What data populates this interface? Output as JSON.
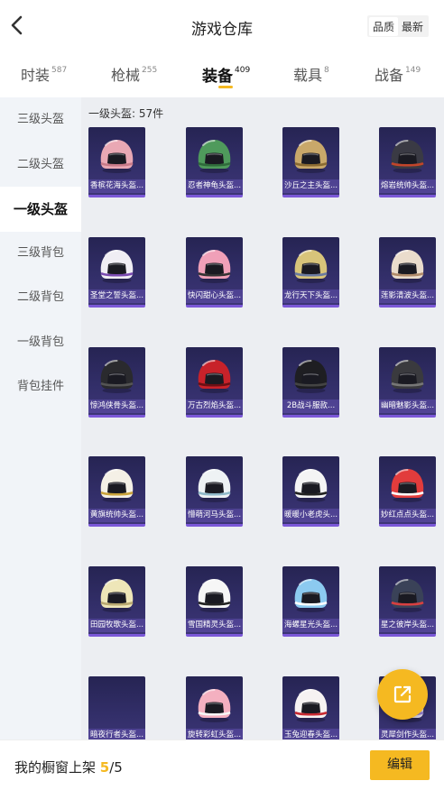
{
  "header": {
    "title": "游戏仓库",
    "sort_options": [
      "品质",
      "最新"
    ]
  },
  "tabs": [
    {
      "label": "时装",
      "count": "587"
    },
    {
      "label": "枪械",
      "count": "255"
    },
    {
      "label": "装备",
      "count": "409"
    },
    {
      "label": "载具",
      "count": "8"
    },
    {
      "label": "战备",
      "count": "149"
    }
  ],
  "sidebar": {
    "items": [
      "三级头盔",
      "二级头盔",
      "一级头盔",
      "三级背包",
      "二级背包",
      "一级背包",
      "背包挂件"
    ]
  },
  "main": {
    "count_label": "一级头盔: 57件",
    "items": [
      {
        "name": "香槟花海头盔...",
        "shell": "#e9a8b4",
        "trim": "#c77a88"
      },
      {
        "name": "忍者神龟头盔...",
        "shell": "#4f9a5c",
        "trim": "#2f6a3b"
      },
      {
        "name": "沙丘之主头盔...",
        "shell": "#c9a86a",
        "trim": "#8a6a32"
      },
      {
        "name": "熔岩统帅头盔...",
        "shell": "#3a3a44",
        "trim": "#c2452a"
      },
      {
        "name": "圣堂之誓头盔...",
        "shell": "#f0eef4",
        "trim": "#7a4ab0"
      },
      {
        "name": "快闪甜心头盔...",
        "shell": "#f0a0b8",
        "trim": "#333333"
      },
      {
        "name": "龙行天下头盔...",
        "shell": "#d8c47a",
        "trim": "#6a7aa0"
      },
      {
        "name": "莲影清波头盔...",
        "shell": "#eadccc",
        "trim": "#b08a6a"
      },
      {
        "name": "惊鸿侠骨头盔...",
        "shell": "#2a2a2e",
        "trim": "#555555"
      },
      {
        "name": "万古烈焰头盔...",
        "shell": "#c8222a",
        "trim": "#6a1014"
      },
      {
        "name": "2B战斗服款...",
        "shell": "#1e1e22",
        "trim": "#444444"
      },
      {
        "name": "幽暗魅影头盔...",
        "shell": "#3a3a3e",
        "trim": "#777777"
      },
      {
        "name": "黄旗统帅头盔...",
        "shell": "#f4f0e6",
        "trim": "#c9a23a"
      },
      {
        "name": "懵萌河马头盔...",
        "shell": "#eef2f4",
        "trim": "#8fb8c8"
      },
      {
        "name": "暖暖小老虎头...",
        "shell": "#f4f4f4",
        "trim": "#222222"
      },
      {
        "name": "妙红点点头盔...",
        "shell": "#e23c3c",
        "trim": "#ffffff"
      },
      {
        "name": "田园牧歌头盔...",
        "shell": "#eee6b8",
        "trim": "#b8a870"
      },
      {
        "name": "雪国精灵头盔...",
        "shell": "#f6f6f6",
        "trim": "#222222"
      },
      {
        "name": "海螺星光头盔...",
        "shell": "#8ccaf0",
        "trim": "#ffffff"
      },
      {
        "name": "星之彼岸头盔...",
        "shell": "#3a4258",
        "trim": "#d84040"
      },
      {
        "name": "暗夜行者头盔...",
        "shell": "#2f2b5c",
        "trim": "#2f2b5c"
      },
      {
        "name": "旋转彩虹头盔...",
        "shell": "#f4b0c0",
        "trim": "#f6f6f6"
      },
      {
        "name": "玉兔迎春头盔...",
        "shell": "#f6f2f2",
        "trim": "#c82a32"
      },
      {
        "name": "灵犀剑作头盔...",
        "shell": "#e6e0f4",
        "trim": "#9a86d8"
      }
    ]
  },
  "bottom": {
    "text": "我的橱窗上架",
    "current": "5",
    "total": "/5",
    "edit_label": "编辑"
  },
  "colors": {
    "accent": "#f5b921",
    "card_bg": "#2f2b63",
    "card_border": "#7b58d8"
  }
}
